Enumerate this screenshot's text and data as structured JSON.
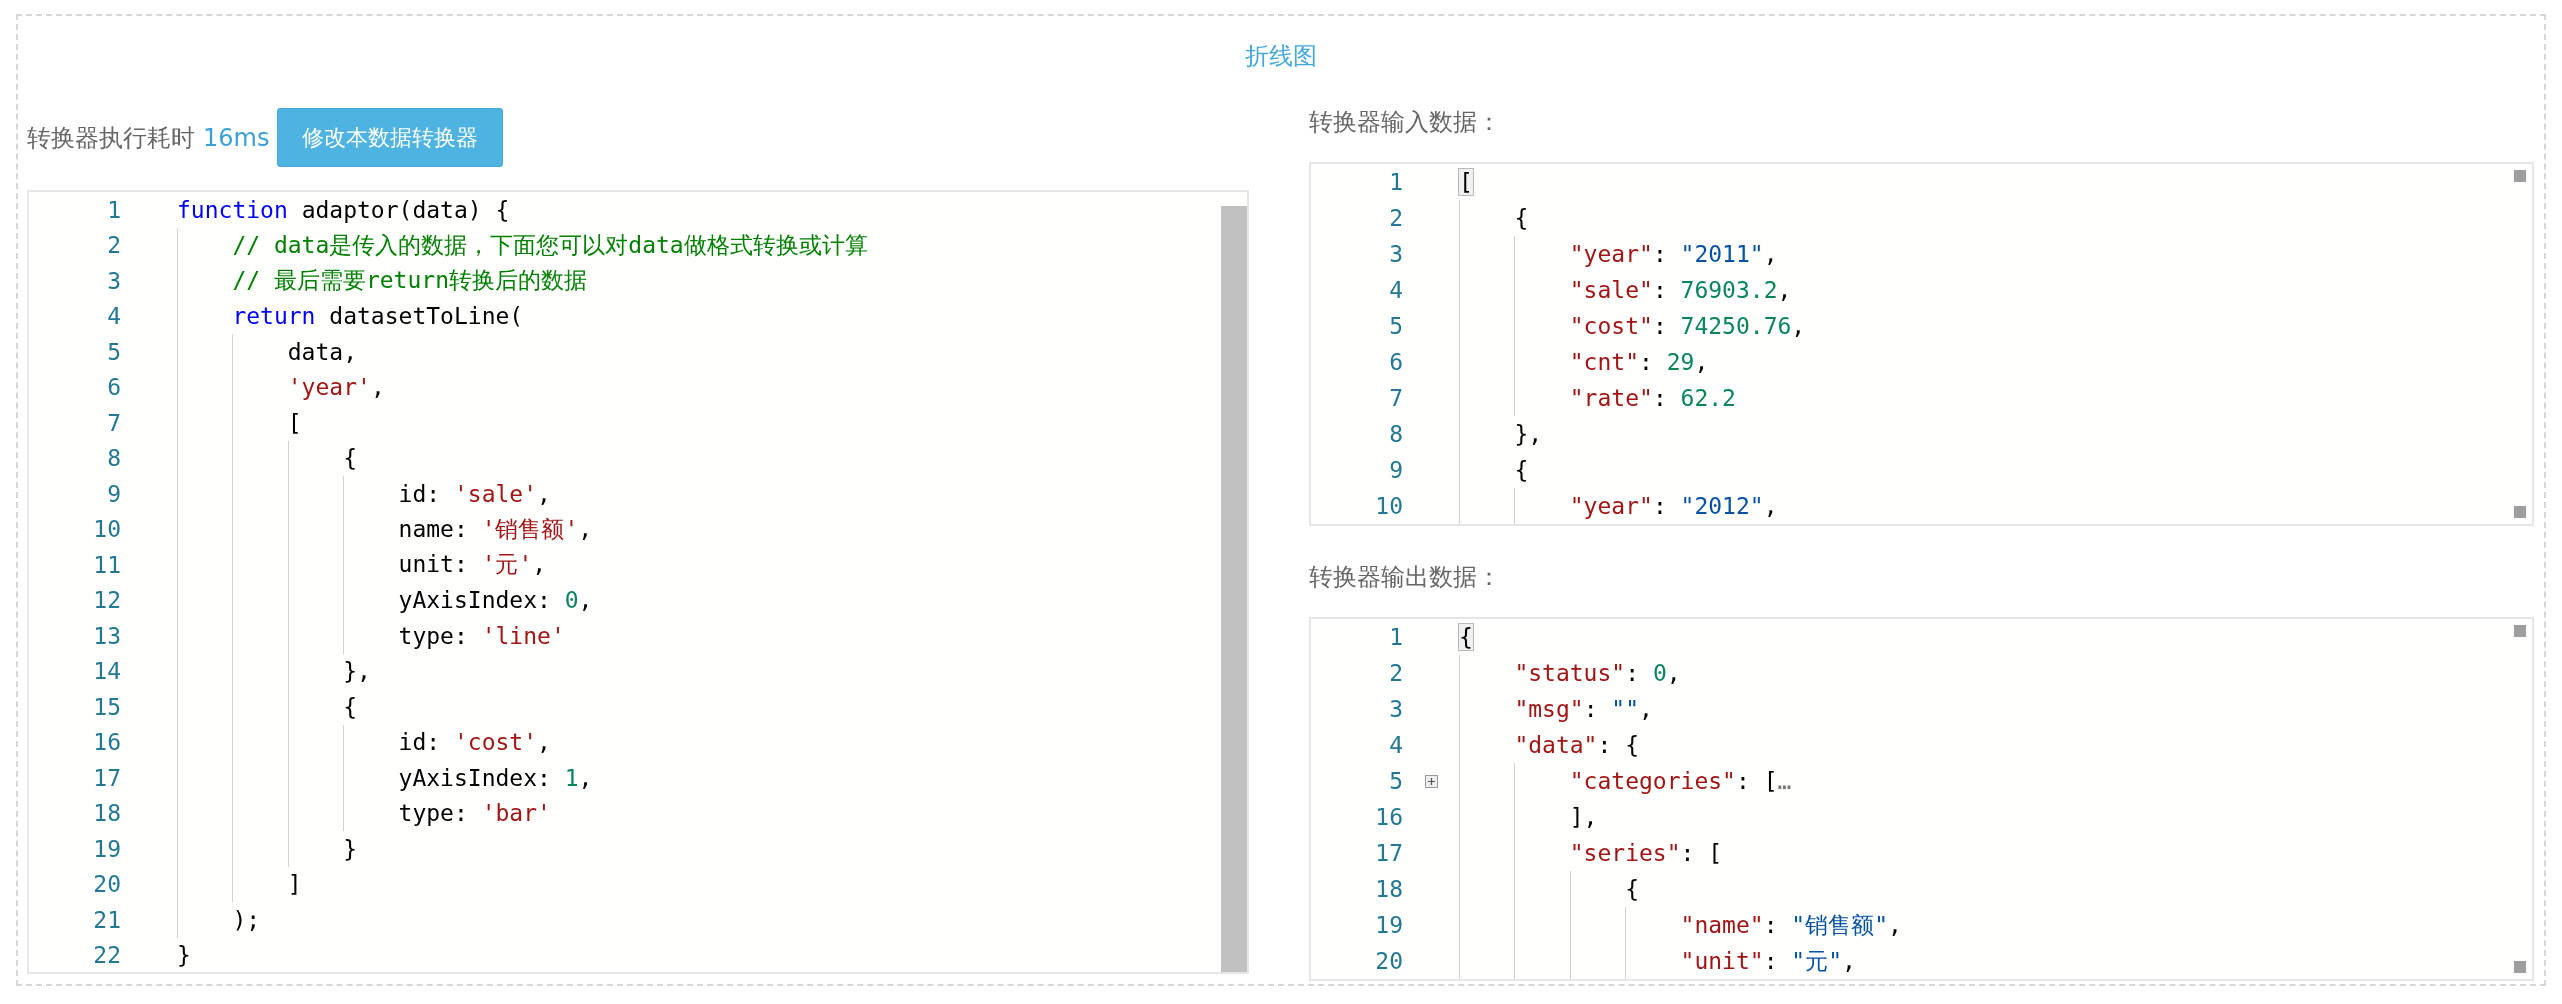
{
  "title": "折线图",
  "converter": {
    "label": "转换器执行耗时",
    "time": "16ms",
    "edit_button": "修改本数据转换器",
    "code": [
      {
        "number": "1",
        "tokens": [
          {
            "kind": "kw",
            "text": "function"
          },
          {
            "kind": "plain",
            "text": " adaptor(data) {"
          }
        ]
      },
      {
        "number": "2",
        "tokens": [
          {
            "kind": "comment",
            "text": "    // data是传入的数据，下面您可以对data做格式转换或计算"
          }
        ]
      },
      {
        "number": "3",
        "tokens": [
          {
            "kind": "comment",
            "text": "    // 最后需要return转换后的数据"
          }
        ]
      },
      {
        "number": "4",
        "tokens": [
          {
            "kind": "kw",
            "text": "    return"
          },
          {
            "kind": "plain",
            "text": " datasetToLine("
          }
        ]
      },
      {
        "number": "5",
        "tokens": [
          {
            "kind": "plain",
            "text": "        data,"
          }
        ]
      },
      {
        "number": "6",
        "tokens": [
          {
            "kind": "str",
            "text": "        'year'"
          },
          {
            "kind": "plain",
            "text": ","
          }
        ]
      },
      {
        "number": "7",
        "tokens": [
          {
            "kind": "plain",
            "text": "        ["
          }
        ]
      },
      {
        "number": "8",
        "tokens": [
          {
            "kind": "plain",
            "text": "            {"
          }
        ]
      },
      {
        "number": "9",
        "tokens": [
          {
            "kind": "plain",
            "text": "                id: "
          },
          {
            "kind": "str",
            "text": "'sale'"
          },
          {
            "kind": "plain",
            "text": ","
          }
        ]
      },
      {
        "number": "10",
        "tokens": [
          {
            "kind": "plain",
            "text": "                name: "
          },
          {
            "kind": "str",
            "text": "'销售额'"
          },
          {
            "kind": "plain",
            "text": ","
          }
        ]
      },
      {
        "number": "11",
        "tokens": [
          {
            "kind": "plain",
            "text": "                unit: "
          },
          {
            "kind": "str",
            "text": "'元'"
          },
          {
            "kind": "plain",
            "text": ","
          }
        ]
      },
      {
        "number": "12",
        "tokens": [
          {
            "kind": "plain",
            "text": "                yAxisIndex: "
          },
          {
            "kind": "num",
            "text": "0"
          },
          {
            "kind": "plain",
            "text": ","
          }
        ]
      },
      {
        "number": "13",
        "tokens": [
          {
            "kind": "plain",
            "text": "                type: "
          },
          {
            "kind": "str",
            "text": "'line'"
          }
        ]
      },
      {
        "number": "14",
        "tokens": [
          {
            "kind": "plain",
            "text": "            },"
          }
        ]
      },
      {
        "number": "15",
        "tokens": [
          {
            "kind": "plain",
            "text": "            {"
          }
        ]
      },
      {
        "number": "16",
        "tokens": [
          {
            "kind": "plain",
            "text": "                id: "
          },
          {
            "kind": "str",
            "text": "'cost'"
          },
          {
            "kind": "plain",
            "text": ","
          }
        ]
      },
      {
        "number": "17",
        "tokens": [
          {
            "kind": "plain",
            "text": "                yAxisIndex: "
          },
          {
            "kind": "num",
            "text": "1"
          },
          {
            "kind": "plain",
            "text": ","
          }
        ]
      },
      {
        "number": "18",
        "tokens": [
          {
            "kind": "plain",
            "text": "                type: "
          },
          {
            "kind": "str",
            "text": "'bar'"
          }
        ]
      },
      {
        "number": "19",
        "tokens": [
          {
            "kind": "plain",
            "text": "            }"
          }
        ]
      },
      {
        "number": "20",
        "tokens": [
          {
            "kind": "plain",
            "text": "        ]"
          }
        ]
      },
      {
        "number": "21",
        "tokens": [
          {
            "kind": "plain",
            "text": "    );"
          }
        ]
      },
      {
        "number": "22",
        "tokens": [
          {
            "kind": "plain",
            "text": "}"
          }
        ]
      }
    ]
  },
  "input": {
    "label": "转换器输入数据：",
    "code": [
      {
        "number": "1",
        "tokens": [
          {
            "kind": "bracket",
            "text": "["
          }
        ]
      },
      {
        "number": "2",
        "tokens": [
          {
            "kind": "plain",
            "text": "    {"
          }
        ]
      },
      {
        "number": "3",
        "tokens": [
          {
            "kind": "key",
            "text": "        \"year\""
          },
          {
            "kind": "plain",
            "text": ": "
          },
          {
            "kind": "value",
            "text": "\"2011\""
          },
          {
            "kind": "plain",
            "text": ","
          }
        ]
      },
      {
        "number": "4",
        "tokens": [
          {
            "kind": "key",
            "text": "        \"sale\""
          },
          {
            "kind": "plain",
            "text": ": "
          },
          {
            "kind": "num",
            "text": "76903.2"
          },
          {
            "kind": "plain",
            "text": ","
          }
        ]
      },
      {
        "number": "5",
        "tokens": [
          {
            "kind": "key",
            "text": "        \"cost\""
          },
          {
            "kind": "plain",
            "text": ": "
          },
          {
            "kind": "num",
            "text": "74250.76"
          },
          {
            "kind": "plain",
            "text": ","
          }
        ]
      },
      {
        "number": "6",
        "tokens": [
          {
            "kind": "key",
            "text": "        \"cnt\""
          },
          {
            "kind": "plain",
            "text": ": "
          },
          {
            "kind": "num",
            "text": "29"
          },
          {
            "kind": "plain",
            "text": ","
          }
        ]
      },
      {
        "number": "7",
        "tokens": [
          {
            "kind": "key",
            "text": "        \"rate\""
          },
          {
            "kind": "plain",
            "text": ": "
          },
          {
            "kind": "num",
            "text": "62.2"
          }
        ]
      },
      {
        "number": "8",
        "tokens": [
          {
            "kind": "plain",
            "text": "    },"
          }
        ]
      },
      {
        "number": "9",
        "tokens": [
          {
            "kind": "plain",
            "text": "    {"
          }
        ]
      },
      {
        "number": "10",
        "tokens": [
          {
            "kind": "key",
            "text": "        \"year\""
          },
          {
            "kind": "plain",
            "text": ": "
          },
          {
            "kind": "value",
            "text": "\"2012\""
          },
          {
            "kind": "plain",
            "text": ","
          }
        ]
      }
    ]
  },
  "output": {
    "label": "转换器输出数据：",
    "code": [
      {
        "number": "1",
        "tokens": [
          {
            "kind": "bracket",
            "text": "{"
          }
        ]
      },
      {
        "number": "2",
        "tokens": [
          {
            "kind": "key",
            "text": "    \"status\""
          },
          {
            "kind": "plain",
            "text": ": "
          },
          {
            "kind": "num",
            "text": "0"
          },
          {
            "kind": "plain",
            "text": ","
          }
        ]
      },
      {
        "number": "3",
        "tokens": [
          {
            "kind": "key",
            "text": "    \"msg\""
          },
          {
            "kind": "plain",
            "text": ": "
          },
          {
            "kind": "value",
            "text": "\"\""
          },
          {
            "kind": "plain",
            "text": ","
          }
        ]
      },
      {
        "number": "4",
        "tokens": [
          {
            "kind": "key",
            "text": "    \"data\""
          },
          {
            "kind": "plain",
            "text": ": {"
          }
        ]
      },
      {
        "number": "5",
        "folded": true,
        "tokens": [
          {
            "kind": "key",
            "text": "        \"categories\""
          },
          {
            "kind": "plain",
            "text": ": ["
          },
          {
            "kind": "fold",
            "text": "…"
          }
        ]
      },
      {
        "number": "16",
        "tokens": [
          {
            "kind": "plain",
            "text": "        ],"
          }
        ]
      },
      {
        "number": "17",
        "tokens": [
          {
            "kind": "key",
            "text": "        \"series\""
          },
          {
            "kind": "plain",
            "text": ": ["
          }
        ]
      },
      {
        "number": "18",
        "tokens": [
          {
            "kind": "plain",
            "text": "            {"
          }
        ]
      },
      {
        "number": "19",
        "tokens": [
          {
            "kind": "key",
            "text": "                \"name\""
          },
          {
            "kind": "plain",
            "text": ": "
          },
          {
            "kind": "value",
            "text": "\"销售额\""
          },
          {
            "kind": "plain",
            "text": ","
          }
        ]
      },
      {
        "number": "20",
        "tokens": [
          {
            "kind": "key",
            "text": "                \"unit\""
          },
          {
            "kind": "plain",
            "text": ": "
          },
          {
            "kind": "value",
            "text": "\"元\""
          },
          {
            "kind": "plain",
            "text": ","
          }
        ]
      }
    ]
  }
}
